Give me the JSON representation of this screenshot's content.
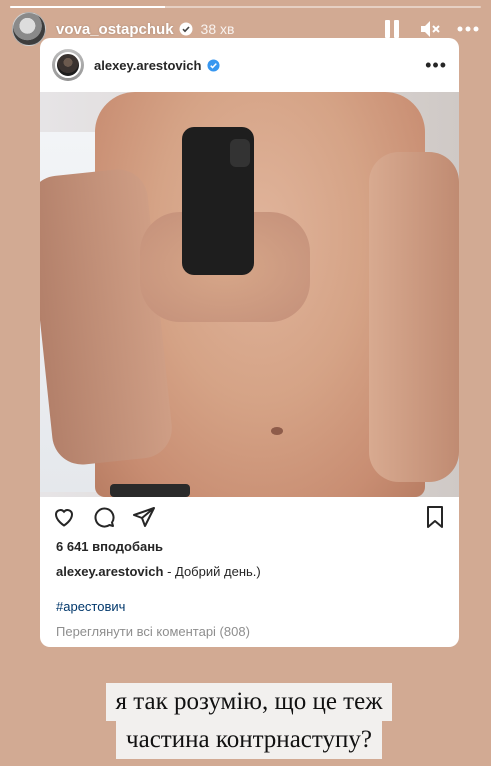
{
  "story": {
    "progress": 0.33,
    "username": "vova_ostapchuk",
    "time": "38 хв",
    "icons": {
      "verified": "verified-badge-icon",
      "pause": "pause-icon",
      "mute": "mute-icon",
      "more": "more-icon"
    }
  },
  "post": {
    "username": "alexey.arestovich",
    "more_glyph": "•••",
    "likes": "6 641 вподобань",
    "caption_user": "alexey.arestovich",
    "caption_text": " - Добрий день.)",
    "hashtag": "#арестович",
    "view_comments": "Переглянути всі коментарі (808)",
    "icons": {
      "like": "heart-icon",
      "comment": "comment-icon",
      "share": "share-icon",
      "save": "bookmark-icon"
    }
  },
  "overlay": {
    "line1": "я так розумію, що це теж",
    "line2": "частина контрнаступу?"
  },
  "colors": {
    "story_background": "#d2aa93",
    "verified": "#3897f0",
    "hashtag": "#00376b"
  }
}
